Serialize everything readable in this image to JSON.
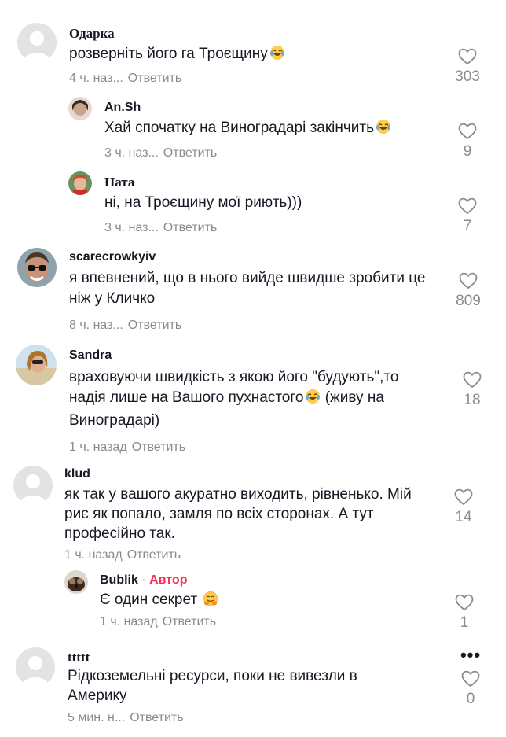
{
  "comments": [
    {
      "name": "Одарка",
      "text": "розверніть його га Троєщину",
      "time": "4 ч. наз...",
      "reply": "Ответить",
      "likes": "303",
      "emoji": "laugh-cry"
    },
    {
      "name": "An.Sh",
      "text": "Хай спочатку на Виноградарі закінчить",
      "time": "3 ч. наз...",
      "reply": "Ответить",
      "likes": "9",
      "emoji": "laugh-cry"
    },
    {
      "name": "Ната",
      "text": "ні, на Троєщину мої риють)))",
      "time": "3 ч. наз...",
      "reply": "Ответить",
      "likes": "7"
    },
    {
      "name": "scarecrowkyiv",
      "text": "я впевнений, що в нього вийде швидше зробити це ніж у Кличко",
      "time": "8 ч. наз...",
      "reply": "Ответить",
      "likes": "809"
    },
    {
      "name": "Sandra",
      "text_before": "враховуючи швидкість з якою його \"будують\",то надія лише на Вашого пухнастого",
      "text_after": " (живу на Виноградарі)",
      "time": "1 ч. назад",
      "reply": "Ответить",
      "likes": "18",
      "emoji": "laugh-cry"
    },
    {
      "name": "klud",
      "text": "як так у вашого акуратно виходить, рівненько. Мій риє як попало, замля по всіх сторонах. А тут професійно так.",
      "time": "1 ч. назад",
      "reply": "Ответить",
      "likes": "14"
    },
    {
      "name": "Bublik",
      "separator": " · ",
      "author_label": "Автор",
      "text": "Є один секрет",
      "time": "1 ч. назад",
      "reply": "Ответить",
      "likes": "1",
      "emoji": "hugging"
    },
    {
      "name": "ttttt",
      "text": "Рідкоземельні ресурси, поки не вивезли в Америку",
      "time": "5 мин. н...",
      "reply": "Ответить",
      "likes": "0",
      "more": "•••"
    }
  ],
  "colors": {
    "text": "#161823",
    "meta": "#8a8b91",
    "author": "#fe2c55",
    "placeholder_avatar": "#e3e3e3"
  }
}
